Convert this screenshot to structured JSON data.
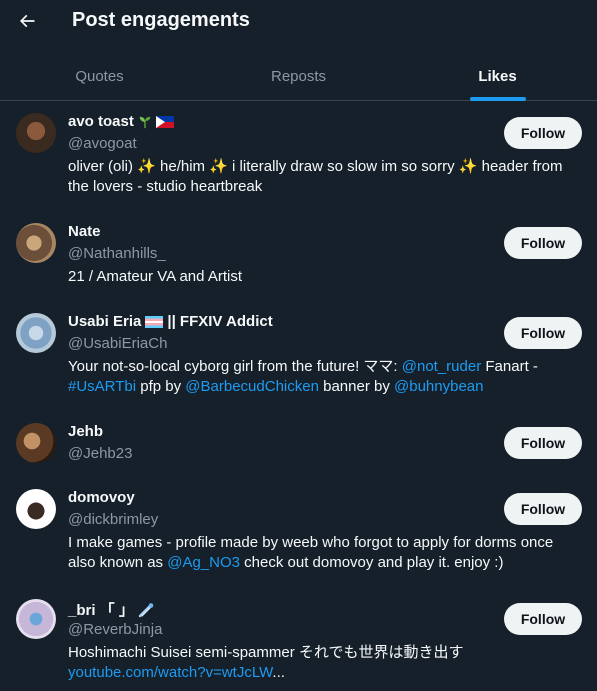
{
  "header": {
    "title": "Post engagements"
  },
  "tabs": [
    {
      "label": "Quotes"
    },
    {
      "label": "Reposts"
    },
    {
      "label": "Likes"
    }
  ],
  "accent_color": "#1d9bf0",
  "users": [
    {
      "name": "avo toast",
      "handle": "@avogoat",
      "follow_label": "Follow",
      "bio": "oliver (oli) ✨ he/him ✨ i literally draw so slow im so sorry ✨ header from the lovers - studio heartbreak"
    },
    {
      "name": "Nate",
      "handle": "@Nathanhills_",
      "follow_label": "Follow",
      "bio": "21 / Amateur VA and Artist"
    },
    {
      "name": "Usabi Eria",
      "name_suffix": "|| FFXIV Addict",
      "handle": "@UsabiEriaCh",
      "follow_label": "Follow",
      "bio_parts": {
        "text1": "Your not-so-local cyborg girl from the future! ママ: ",
        "link1": "@not_ruder",
        "text2": " Fanart - ",
        "link2": "#UsARTbi",
        "text3": " pfp by ",
        "link3": "@BarbecudChicken",
        "text4": " banner by ",
        "link4": "@buhnybean"
      }
    },
    {
      "name": "Jehb",
      "handle": "@Jehb23",
      "follow_label": "Follow"
    },
    {
      "name": "domovoy",
      "handle": "@dickbrimley",
      "follow_label": "Follow",
      "bio_parts": {
        "text1": "I make games - profile made by weeb who forgot to apply for dorms once also known as ",
        "link1": "@Ag_NO3",
        "text2": " check out domovoy and play it. enjoy :)"
      }
    },
    {
      "name": "_bri 「 」",
      "handle": "@ReverbJinja",
      "follow_label": "Follow",
      "bio_parts": {
        "text1": "Hoshimachi Suisei semi-spammer それでも世界は動き出す",
        "link1": "youtube.com/watch?v=wtJcLW",
        "text2": "..."
      }
    }
  ]
}
